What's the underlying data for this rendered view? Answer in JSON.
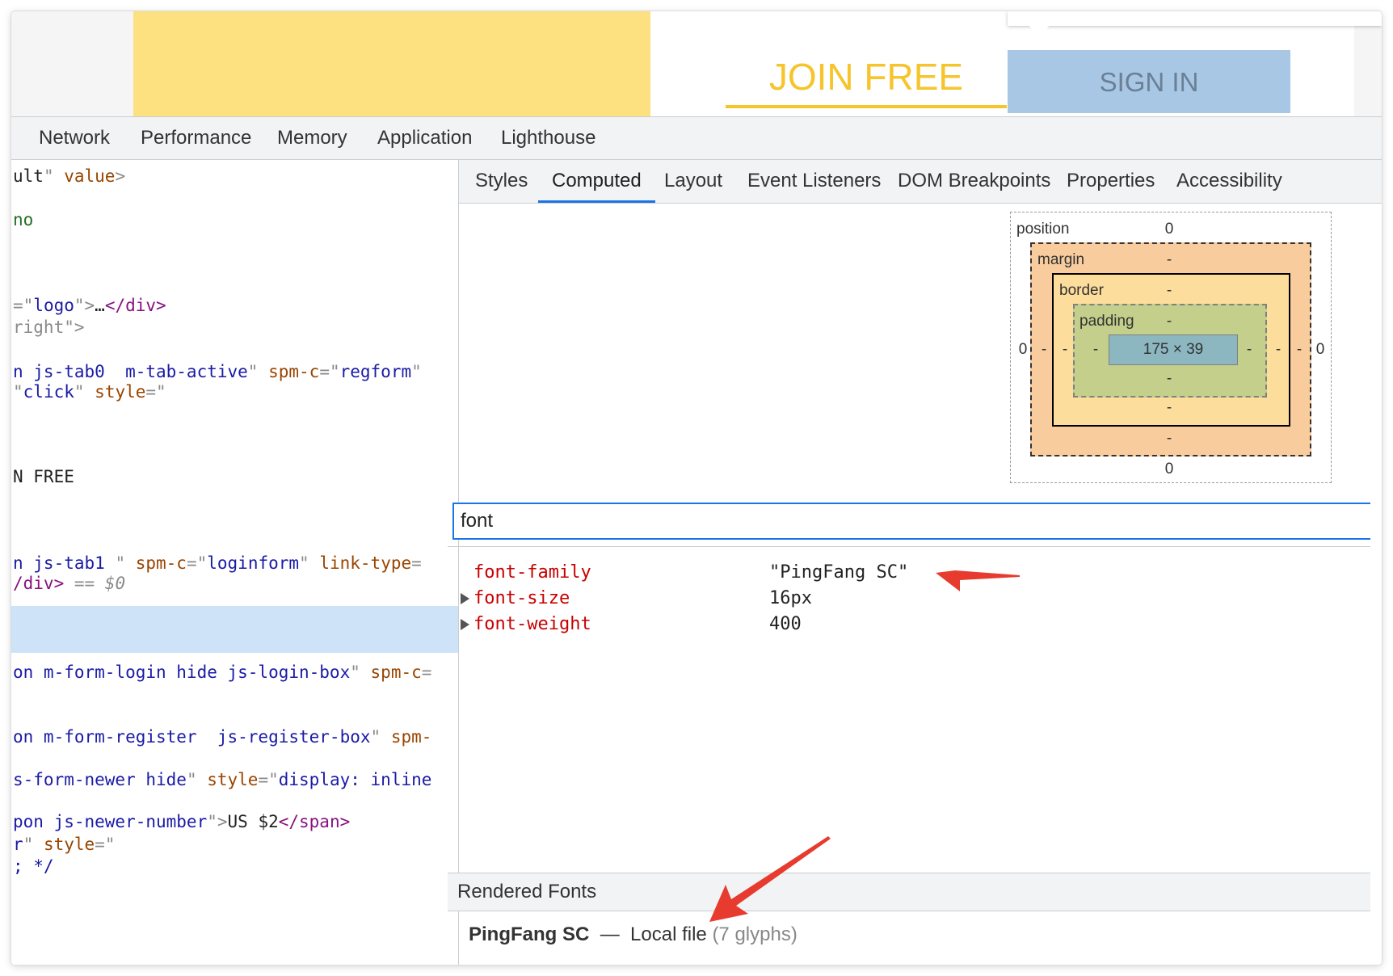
{
  "preview": {
    "join_free": "JOIN FREE",
    "sign_in": "SIGN IN"
  },
  "main_tabs": [
    "Network",
    "Performance",
    "Memory",
    "Application",
    "Lighthouse"
  ],
  "elements": {
    "lines": [
      {
        "parts": [
          [
            "t",
            "ult"
          ],
          [
            "p",
            "\" "
          ],
          [
            "a",
            "value"
          ],
          [
            "p",
            ">"
          ]
        ]
      },
      {
        "parts": [
          [
            "g",
            "no"
          ]
        ]
      },
      {
        "parts": [
          [
            "p",
            "=\""
          ],
          [
            "v",
            "logo"
          ],
          [
            "p",
            "\">"
          ],
          [
            "t",
            "…"
          ],
          [
            "tag",
            "</div>"
          ]
        ]
      },
      {
        "parts": [
          [
            "p",
            "right\">"
          ]
        ]
      },
      {
        "parts": [
          [
            "v",
            "n js-tab0  m-tab-active"
          ],
          [
            "p",
            "\" "
          ],
          [
            "a",
            "spm-c"
          ],
          [
            "p",
            "=\""
          ],
          [
            "v",
            "regform"
          ],
          [
            "p",
            "\""
          ]
        ]
      },
      {
        "parts": [
          [
            "p",
            "\""
          ],
          [
            "v",
            "click"
          ],
          [
            "p",
            "\" "
          ],
          [
            "a",
            "style"
          ],
          [
            "p",
            "=\""
          ]
        ]
      },
      {
        "parts": [
          [
            "t",
            "N FREE"
          ]
        ]
      },
      {
        "parts": [
          [
            "v",
            "n js-tab1 "
          ],
          [
            "p",
            "\" "
          ],
          [
            "a",
            "spm-c"
          ],
          [
            "p",
            "=\""
          ],
          [
            "v",
            "loginform"
          ],
          [
            "p",
            "\" "
          ],
          [
            "a",
            "link-type"
          ],
          [
            "p",
            "="
          ]
        ]
      },
      {
        "parts": [
          [
            "tag",
            "/div>"
          ],
          [
            "p",
            " == "
          ],
          [
            "i",
            "$0"
          ]
        ]
      },
      {
        "parts": [
          [
            "v",
            "on m-form-login hide js-login-box"
          ],
          [
            "p",
            "\" "
          ],
          [
            "a",
            "spm-c"
          ],
          [
            "p",
            "="
          ]
        ]
      },
      {
        "parts": [
          [
            "v",
            "on m-form-register  js-register-box"
          ],
          [
            "p",
            "\" "
          ],
          [
            "a",
            "spm-"
          ]
        ]
      },
      {
        "parts": [
          [
            "v",
            "s-form-newer hide"
          ],
          [
            "p",
            "\" "
          ],
          [
            "a",
            "style"
          ],
          [
            "p",
            "=\""
          ],
          [
            "v",
            "display: inline"
          ]
        ]
      },
      {
        "parts": [
          [
            "v",
            "pon js-newer-number"
          ],
          [
            "p",
            "\">"
          ],
          [
            "t",
            "US $2"
          ],
          [
            "tag",
            "</span>"
          ]
        ]
      },
      {
        "parts": [
          [
            "v",
            "r"
          ],
          [
            "p",
            "\" "
          ],
          [
            "a",
            "style"
          ],
          [
            "p",
            "=\""
          ]
        ]
      },
      {
        "parts": [
          [
            "v",
            "; */"
          ]
        ]
      }
    ]
  },
  "sub_tabs": [
    "Styles",
    "Computed",
    "Layout",
    "Event Listeners",
    "DOM Breakpoints",
    "Properties",
    "Accessibility"
  ],
  "active_sub_tab": "Computed",
  "box_model": {
    "position_label": "position",
    "margin_label": "margin",
    "border_label": "border",
    "padding_label": "padding",
    "position_top": "0",
    "position_bottom": "0",
    "position_left": "0",
    "position_right": "0",
    "margin_top": "-",
    "margin_bottom": "-",
    "margin_left": "-",
    "margin_right": "-",
    "border_top": "-",
    "border_bottom": "-",
    "border_left": "-",
    "border_right": "-",
    "padding_top": "-",
    "padding_bottom": "-",
    "padding_left": "-",
    "padding_right": "-",
    "content": "175 × 39"
  },
  "filter": {
    "value": "font"
  },
  "properties": [
    {
      "name": "font-family",
      "value": "\"PingFang SC\"",
      "expandable": false
    },
    {
      "name": "font-size",
      "value": "16px",
      "expandable": true
    },
    {
      "name": "font-weight",
      "value": "400",
      "expandable": true
    }
  ],
  "rendered_fonts": {
    "header": "Rendered Fonts",
    "font_name": "PingFang SC",
    "separator": "—",
    "source": "Local file",
    "glyphs": "(7 glyphs)"
  },
  "colors": {
    "accent": "#1a73e8",
    "annotation_arrow": "#e63b2e",
    "join_free": "#f6c42b",
    "sign_in_bg": "#a8c7e5"
  }
}
